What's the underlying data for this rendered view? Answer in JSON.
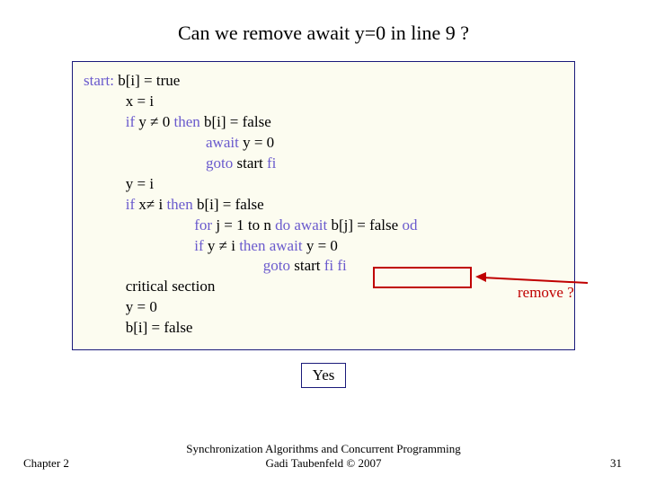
{
  "title": "Can we remove await y=0 in line 9 ?",
  "code": {
    "l1_a": "start: ",
    "l1_b": "b[i] = true",
    "l2": "           x = i",
    "l3_a": "           if ",
    "l3_b": "y ≠ 0 ",
    "l3_c": "then ",
    "l3_d": "b[i] = false",
    "l4_a": "                                await ",
    "l4_b": "y = 0",
    "l5_a": "                                goto ",
    "l5_b": "start ",
    "l5_c": "fi",
    "l6": "           y = i",
    "l7_a": "           if ",
    "l7_b": "x≠ i ",
    "l7_c": "then ",
    "l7_d": "b[i] = false",
    "l8_a": "                             for ",
    "l8_b": "j = 1 to n ",
    "l8_c": "do await ",
    "l8_d": "b[j] = false ",
    "l8_e": "od",
    "l9_a": "                             if ",
    "l9_b": "y ≠ i ",
    "l9_c": "then ",
    "l9_d": "await ",
    "l9_e": "y = 0",
    "l10_a": "                                               goto ",
    "l10_b": "start ",
    "l10_c": "fi fi",
    "l11": "           critical section",
    "l12": "           y = 0",
    "l13": "           b[i] = false"
  },
  "remove_label": "remove ?",
  "answer": "Yes",
  "chapter": "Chapter 2",
  "credit_line1": "Synchronization Algorithms and Concurrent Programming",
  "credit_line2": "Gadi Taubenfeld © 2007",
  "page_number": "31"
}
